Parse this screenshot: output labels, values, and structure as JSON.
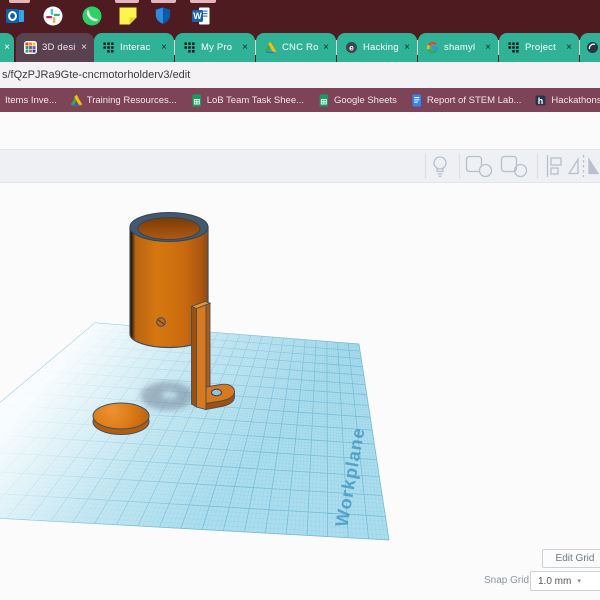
{
  "colors": {
    "chrome_dark": "#4e1b20",
    "tab_teal": "#2fb295",
    "active_tab": "#5a4150",
    "bookmark_bar": "#7d4457",
    "model_orange": "#d4741a",
    "workplane_blue": "#aadded",
    "outline": "#3e5065"
  },
  "taskbar": {
    "icons": [
      "outlook",
      "slack",
      "whatsapp",
      "sticky-notes",
      "defender-shield",
      "word"
    ]
  },
  "browser": {
    "close_glyph": "×",
    "tabs": [
      {
        "label": "3D desi",
        "active": true,
        "icon": "tinkercad-color"
      },
      {
        "label": "Interac",
        "icon": "tinkercad-dots"
      },
      {
        "label": "My Pro",
        "icon": "tinkercad-dots"
      },
      {
        "label": "CNC Ro",
        "icon": "google-drive"
      },
      {
        "label": "Hacking",
        "icon": "e-circle"
      },
      {
        "label": "shamyl",
        "icon": "google-g"
      },
      {
        "label": "Project",
        "icon": "tinkercad-dots"
      }
    ],
    "url": "s/fQzPJRa9Gte-cncmotorholderv3/edit",
    "bookmarks": [
      {
        "label": "Items Inve...",
        "icon": "none"
      },
      {
        "label": "Training Resources...",
        "icon": "google-drive"
      },
      {
        "label": "LoB Team Task Shee...",
        "icon": "sheets"
      },
      {
        "label": "Google Sheets",
        "icon": "sheets"
      },
      {
        "label": "Report of STEM Lab...",
        "icon": "docs"
      },
      {
        "label": "Hackathons, P",
        "icon": "h-square"
      }
    ]
  },
  "editor": {
    "toolbar_icons": [
      "show-all-lightbulb",
      "group",
      "ungroup",
      "align",
      "mirror"
    ],
    "workplane_label": "Workplane",
    "edit_grid_label": "Edit Grid",
    "snap_grid_label": "Snap Grid",
    "snap_grid_value": "1.0 mm",
    "snap_caret": "▾",
    "scene_objects": [
      "motor-holder-cylinder",
      "mount-bracket",
      "base-disc"
    ]
  }
}
